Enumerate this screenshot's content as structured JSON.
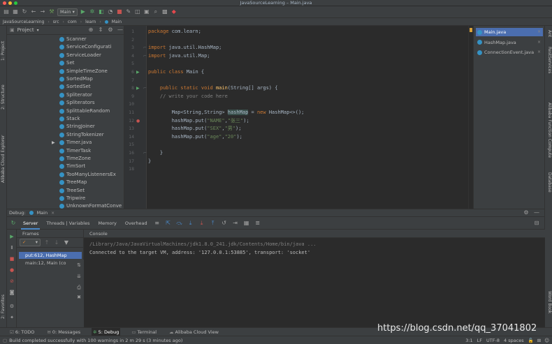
{
  "window": {
    "title": "JavaSourceLearning – Main.java"
  },
  "toolbar": {
    "run_config": "Main",
    "run_config_suffix": "▾"
  },
  "navbar": {
    "crumbs": [
      "JavaSourceLearning",
      "src",
      "com",
      "learn",
      "Main"
    ]
  },
  "left_strip": {
    "project": "1: Project",
    "structure": "2: Structure",
    "alibaba": "Alibaba Cloud Explorer",
    "favorites": "2: Favorites"
  },
  "right_strip": {
    "ant": "Ant",
    "realtime": "RestServices",
    "function": "Alibaba Function Compute",
    "database": "Database",
    "word": "Word Book"
  },
  "project": {
    "title": "Project",
    "items": [
      "Scanner",
      "ServiceConfigurati",
      "ServiceLoader",
      "Set",
      "SimpleTimeZone",
      "SortedMap",
      "SortedSet",
      "Spliterator",
      "Spliterators",
      "SplittableRandom",
      "Stack",
      "StringJoiner",
      "StringTokenizer",
      "Timer.java",
      "TimerTask",
      "TimeZone",
      "TimSort",
      "TooManyListenersEx",
      "TreeMap",
      "TreeSet",
      "Tripwire",
      "UnknownFormatConve"
    ]
  },
  "editor": {
    "line_numbers": [
      "1",
      "2",
      "3",
      "4",
      "5",
      "6",
      "7",
      "8",
      "9",
      "10",
      "11",
      "12",
      "13",
      "14",
      "15",
      "16",
      "17",
      "18"
    ],
    "lines": [
      [
        {
          "t": "package ",
          "c": "kw"
        },
        {
          "t": "com.learn;",
          "c": ""
        }
      ],
      [],
      [
        {
          "t": "import ",
          "c": "kw"
        },
        {
          "t": "java.util.HashMap;",
          "c": ""
        }
      ],
      [
        {
          "t": "import ",
          "c": "kw"
        },
        {
          "t": "java.util.Map;",
          "c": ""
        }
      ],
      [],
      [
        {
          "t": "public class ",
          "c": "kw"
        },
        {
          "t": "Main {",
          "c": ""
        }
      ],
      [],
      [
        {
          "t": "    public static void ",
          "c": "kw"
        },
        {
          "t": "main",
          "c": "fn"
        },
        {
          "t": "(String[] args) {",
          "c": ""
        }
      ],
      [
        {
          "t": "    // write your code here",
          "c": "cmt"
        }
      ],
      [],
      [
        {
          "t": "        Map<String,String> ",
          "c": ""
        },
        {
          "t": "hashMap",
          "c": "hl"
        },
        {
          "t": " = ",
          "c": ""
        },
        {
          "t": "new ",
          "c": "kw"
        },
        {
          "t": "HashMap<>();",
          "c": ""
        }
      ],
      [
        {
          "t": "        hashMap.put(",
          "c": ""
        },
        {
          "t": "\"NAME\"",
          "c": "str"
        },
        {
          "t": ",",
          "c": ""
        },
        {
          "t": "\"张三\"",
          "c": "str"
        },
        {
          "t": ");",
          "c": ""
        }
      ],
      [
        {
          "t": "        hashMap.put(",
          "c": ""
        },
        {
          "t": "\"SEX\"",
          "c": "str"
        },
        {
          "t": ",",
          "c": ""
        },
        {
          "t": "\"男\"",
          "c": "str"
        },
        {
          "t": ");",
          "c": ""
        }
      ],
      [
        {
          "t": "        hashMap.put(",
          "c": ""
        },
        {
          "t": "\"age\"",
          "c": "str"
        },
        {
          "t": ",",
          "c": ""
        },
        {
          "t": "\"20\"",
          "c": "str"
        },
        {
          "t": ");",
          "c": ""
        }
      ],
      [],
      [
        {
          "t": "    }",
          "c": ""
        }
      ],
      [
        {
          "t": "}",
          "c": ""
        }
      ],
      []
    ]
  },
  "recent_files": [
    {
      "name": "Main.java",
      "selected": true
    },
    {
      "name": "HashMap.java",
      "selected": false
    },
    {
      "name": "ConnectionEvent.java",
      "selected": false
    }
  ],
  "debug": {
    "label": "Debug:",
    "session": "Main",
    "tabs": [
      "Server",
      "Threads | Variables",
      "Memory",
      "Overhead"
    ],
    "frames_title": "Frames",
    "frames": [
      {
        "text": "put:612, HashMap",
        "selected": true
      },
      {
        "text": "main:12, Main (co",
        "selected": false
      }
    ],
    "console_title": "Console",
    "console_lines": [
      {
        "text": "/Library/Java/JavaVirtualMachines/jdk1.8.0_241.jdk/Contents/Home/bin/java ...",
        "color": "#808080"
      },
      {
        "text": "Connected to the target VM, address: '127.0.0.1:53885', transport: 'socket'",
        "color": "#bbbbbb"
      }
    ]
  },
  "bottom_tabs": [
    {
      "label": "6: TODO",
      "active": false
    },
    {
      "label": "0: Messages",
      "active": false
    },
    {
      "label": "5: Debug",
      "active": true
    },
    {
      "label": "Terminal",
      "active": false
    },
    {
      "label": "Alibaba Cloud View",
      "active": false
    }
  ],
  "status": {
    "message": "Build completed successfully with 100 warnings in 2 m 29 s (3 minutes ago)",
    "position": "3:1",
    "line_sep": "LF",
    "encoding": "UTF-8",
    "indent": "4 spaces"
  },
  "watermark": "https://blog.csdn.net/qq_37041802",
  "colors": {
    "accent": "#4b6eaf",
    "keyword": "#cc7832",
    "string": "#6a8759",
    "comment": "#808080"
  }
}
